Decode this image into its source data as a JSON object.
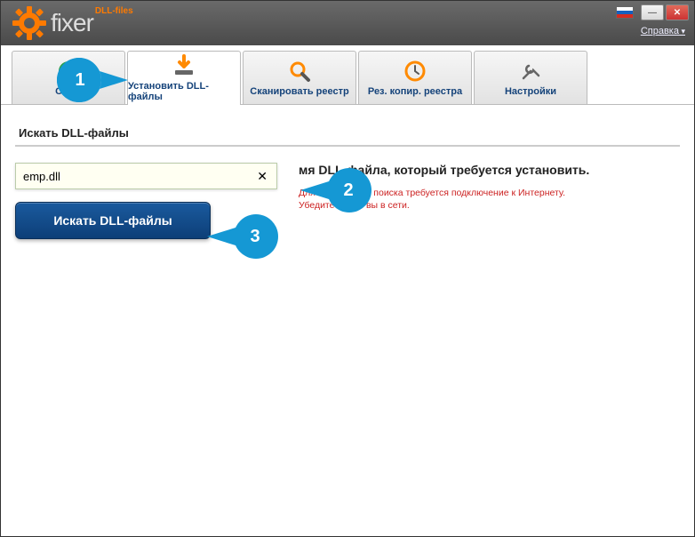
{
  "app": {
    "brand": "fixer",
    "brand_super": "DLL-files",
    "help_label": "Справка"
  },
  "window_controls": {
    "minimize": "—",
    "close": "✕"
  },
  "tabs": [
    {
      "label": "Сос..."
    },
    {
      "label": "Установить DLL-файлы"
    },
    {
      "label": "Сканировать реестр"
    },
    {
      "label": "Рез. копир. реестра"
    },
    {
      "label": "Настройки"
    }
  ],
  "section": {
    "title": "Искать DLL-файлы"
  },
  "search": {
    "value": "emp.dll",
    "clear": "✕",
    "button": "Искать DLL-файлы"
  },
  "instruction": {
    "main_partial": "мя DLL-файла, который требуется установить.",
    "warning_line1": "Для выполнения поиска требуется подключение к Интернету.",
    "warning_line2": "Убедитесь, что вы в сети."
  },
  "callouts": {
    "c1": "1",
    "c2": "2",
    "c3": "3"
  }
}
